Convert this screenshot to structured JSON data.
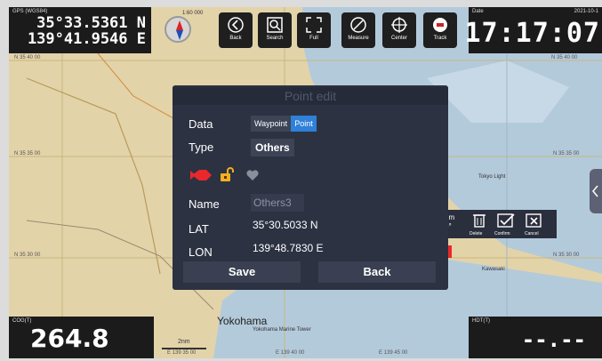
{
  "gps": {
    "label": "GPS (WGS84)",
    "lat": "35°33.5361 N",
    "lon": "139°41.9546 E"
  },
  "scale_label": "1:60 000",
  "toolbar": {
    "back": "Back",
    "search": "Search",
    "full": "Full",
    "measure": "Measure",
    "center": "Center",
    "track": "Track"
  },
  "date": {
    "label": "Date",
    "value": "2021-10-1",
    "time": "17:17:07"
  },
  "map_labels": {
    "top_left": "N 35 40 00",
    "top_right": "N 35 40 00",
    "mid_left": "N 35 35 00",
    "mid_right": "N 35 35 00",
    "low_left": "N 35 30 00",
    "low_right": "N 35 30 00",
    "poi_1": "Tokyo Light",
    "poi_2": "Kawasaki",
    "city": "Yokohama",
    "tower": "Yokohama Marine Tower",
    "bottom_1": "E 139 35 00",
    "bottom_2": "E 139 40 00",
    "bottom_3": "E 139 45 00",
    "scalebar": "2nm"
  },
  "dialog": {
    "title": "Point edit",
    "data_label": "Data",
    "data_options": [
      "Waypoint",
      "Point"
    ],
    "data_selected": "Point",
    "type_label": "Type",
    "type_value": "Others",
    "name_label": "Name",
    "name_value": "Others3",
    "lat_label": "LAT",
    "lat_value": "35°30.5033 N",
    "lon_label": "LON",
    "lon_value": "139°48.7830 E",
    "save": "Save",
    "back": "Back"
  },
  "tool_panel": {
    "partial_text_1": "nm",
    "partial_text_2": "6°",
    "delete": "Delete",
    "confirm": "Confirm",
    "cancel": "Cancel"
  },
  "cog": {
    "label": "COG(T)",
    "value": "264.8"
  },
  "hdg": {
    "label": "HDT(T)",
    "value": "--.--"
  },
  "colors": {
    "panel": "#1b1b1b",
    "dialog": "#2c3242",
    "accent": "#2f80d8",
    "waypoint_red": "#e8282b",
    "lock_yellow": "#f0b020",
    "land": "#e6d8b4",
    "water": "#aec7dc"
  },
  "icons": [
    "compass-icon",
    "back-icon",
    "search-icon",
    "full-screen-icon",
    "measure-icon",
    "center-icon",
    "track-icon",
    "fish-icon",
    "unlock-icon",
    "heart-icon",
    "delete-icon",
    "confirm-icon",
    "cancel-icon"
  ]
}
